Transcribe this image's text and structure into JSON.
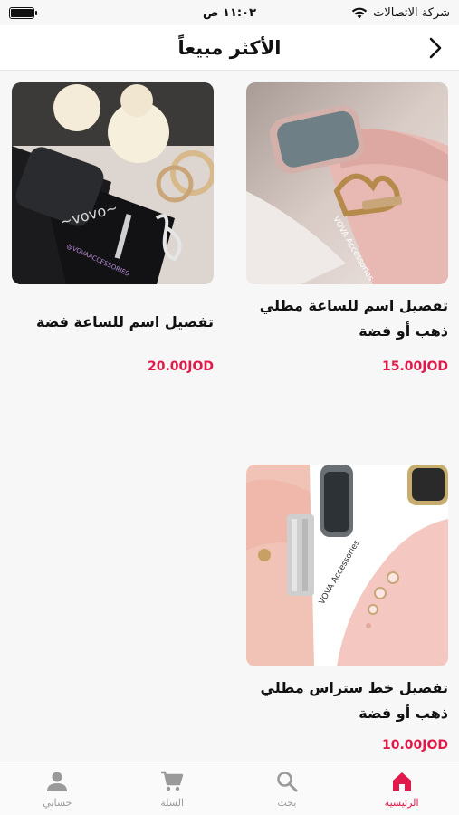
{
  "status_bar": {
    "carrier": "شركة الاتصالات",
    "time": "١١:٠٣ ص"
  },
  "header": {
    "title": "الأكثر مبيعاً"
  },
  "products": [
    {
      "name": "تفصيل اسم للساعة مطلي ذهب أو فضة",
      "price": "15.00JOD",
      "image": "pink-watch-gold-letters"
    },
    {
      "name": "تفصيل اسم للساعة فضة",
      "price": "20.00JOD",
      "image": "black-watch-silver-name"
    },
    {
      "name": "تفصيل خط ستراس مطلي ذهب أو فضة",
      "price": "10.00JOD",
      "image": "pink-watch-rhinestone-charms"
    }
  ],
  "tabbar": {
    "items": [
      {
        "label": "الرئيسية",
        "icon": "home-icon",
        "active": true
      },
      {
        "label": "بحث",
        "icon": "search-icon",
        "active": false
      },
      {
        "label": "السلة",
        "icon": "cart-icon",
        "active": false
      },
      {
        "label": "حسابي",
        "icon": "user-icon",
        "active": false
      }
    ]
  },
  "colors": {
    "accent": "#e0194a",
    "inactive": "#9a9a9a"
  }
}
